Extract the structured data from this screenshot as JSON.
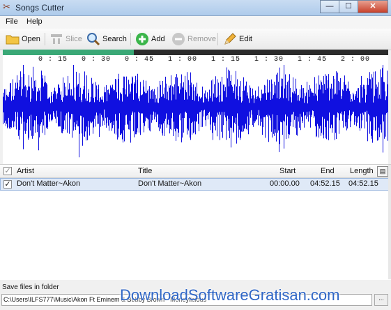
{
  "window": {
    "title": "Songs Cutter",
    "controls": {
      "minimize": "—",
      "maximize": "☐",
      "close": "✕"
    }
  },
  "menu": [
    "File",
    "Help"
  ],
  "toolbar": {
    "open": "Open",
    "slice": "Slice",
    "search": "Search",
    "add": "Add",
    "remove": "Remove",
    "edit": "Edit"
  },
  "player": {
    "progress_fraction": 0.34,
    "played_color": "#3aa876",
    "wave_color": "#1010e0"
  },
  "timeline": [
    "0 : 15",
    "0 : 30",
    "0 : 45",
    "1 : 00",
    "1 : 15",
    "1 : 30",
    "1 : 45",
    "2 : 00"
  ],
  "list": {
    "headers": {
      "artist": "Artist",
      "title": "Title",
      "start": "Start",
      "end": "End",
      "length": "Length"
    },
    "rows": [
      {
        "checked": true,
        "artist": "Don't Matter~Akon",
        "title": "Don't Matter~Akon",
        "start": "00:00.00",
        "end": "04:52.15",
        "length": "04:52.15"
      }
    ]
  },
  "status": {
    "label": "Save files in folder",
    "path": "C:\\Users\\ILFS777\\Music\\Akon Ft Eminem & Bobby Brown - Moneylicious",
    "browse_label": "..."
  },
  "watermark": "DownloadSoftwareGratisan.com"
}
